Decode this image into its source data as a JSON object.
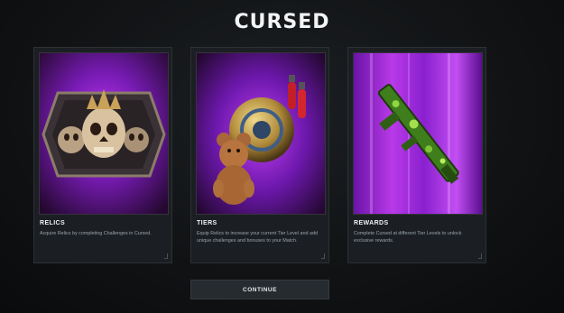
{
  "title": "CURSED",
  "cards": [
    {
      "heading": "RELICS",
      "description": "Acquire Relics by completing Challenges in Cursed."
    },
    {
      "heading": "TIERS",
      "description": "Equip Relics to increase your current Tier Level and add unique challenges and bonuses to your Match."
    },
    {
      "heading": "REWARDS",
      "description": "Complete Cursed at different Tier Levels to unlock exclusive rewards."
    }
  ],
  "continue_label": "CONTINUE",
  "colors": {
    "accent_purple": "#8a1fd8",
    "background": "#111315",
    "button": "#262b30"
  }
}
